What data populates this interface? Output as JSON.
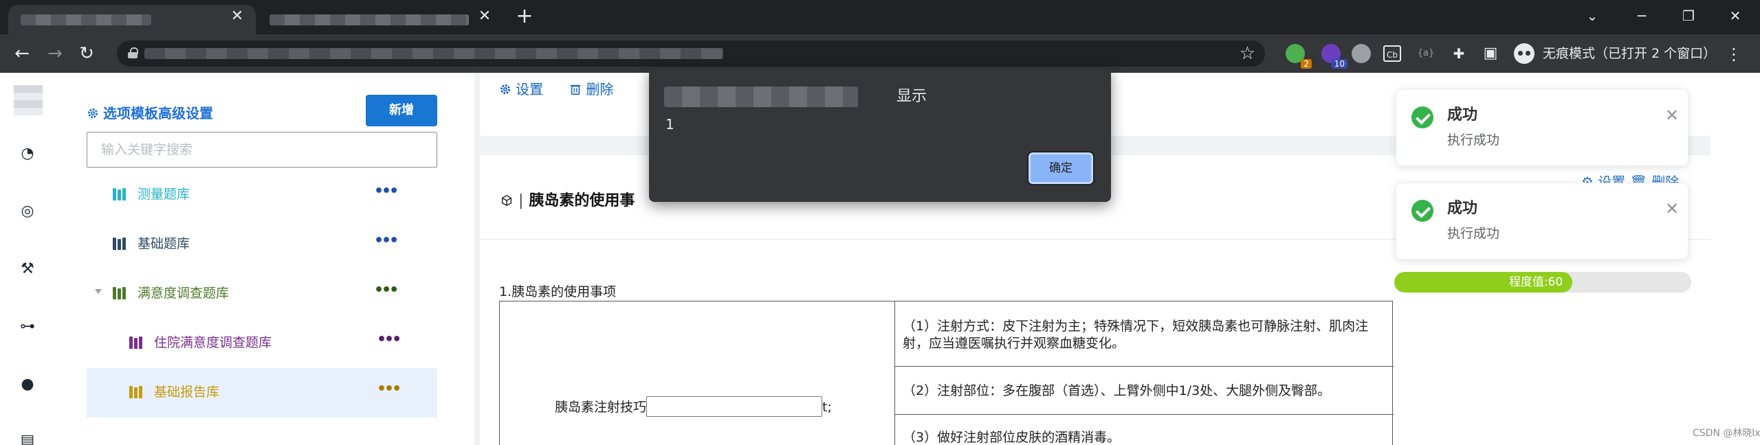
{
  "browser": {
    "tabs": [
      {
        "title": "",
        "active": true,
        "close_glyph": "✕"
      },
      {
        "title": "",
        "active": false,
        "close_glyph": "✕"
      }
    ],
    "new_tab_glyph": "+",
    "window_controls": {
      "menu": "⌄",
      "minimize": "─",
      "restore": "❐",
      "close": "✕"
    },
    "nav": {
      "back": "←",
      "forward": "→",
      "reload": "↻"
    },
    "url": "",
    "bookmark_glyph": "☆",
    "extensions": [
      {
        "icon": "green-circle-extension-icon",
        "badge": "2",
        "color": "#4caf50",
        "badge_color": "#c77800"
      },
      {
        "icon": "purple-extension-icon",
        "badge": "10",
        "color": "#6a3fbf",
        "badge_color": "#3949ab"
      },
      {
        "icon": "palette-icon",
        "badge": "",
        "color": "#9aa0a6",
        "badge_color": ""
      },
      {
        "icon": "cb-extension-icon",
        "badge": "",
        "label": "Cb",
        "color": "",
        "badge_color": ""
      },
      {
        "icon": "braces-extension-icon",
        "badge": "",
        "label": "{a}",
        "color": "",
        "badge_color": ""
      },
      {
        "icon": "puzzle-icon",
        "badge": "",
        "label": "✚",
        "color": "",
        "badge_color": ""
      },
      {
        "icon": "side-panel-icon",
        "badge": "",
        "label": "▣",
        "color": "",
        "badge_color": ""
      }
    ],
    "incognito_label": "无痕模式（已打开 2 个窗口）",
    "menu_glyph": "⋮"
  },
  "sidebar": {
    "icons": [
      "dashboard-icon",
      "target-icon",
      "tools-icon",
      "org-chart-icon",
      "user-icon",
      "document-icon"
    ],
    "glyphs": [
      "◔",
      "◎",
      "⚒",
      "⊶",
      "●",
      "▤"
    ]
  },
  "tree_panel": {
    "title": "选项模板高级设置",
    "add_button": "新增",
    "search_placeholder": "输入关键字搜索",
    "nodes": [
      {
        "label": "测量题库",
        "color": "#26b4c9",
        "indent": 0,
        "expandable": false,
        "selected": false
      },
      {
        "label": "基础题库",
        "color": "#2e4a62",
        "indent": 0,
        "expandable": false,
        "selected": false
      },
      {
        "label": "满意度调查题库",
        "color": "#4e7a2a",
        "indent": 0,
        "expandable": true,
        "selected": false
      },
      {
        "label": "住院满意度调查题库",
        "color": "#7b2e8e",
        "indent": 1,
        "expandable": false,
        "selected": false
      },
      {
        "label": "基础报告库",
        "color": "#c79a10",
        "indent": 1,
        "expandable": false,
        "selected": true
      }
    ],
    "more_glyph": "•••"
  },
  "main": {
    "card_actions": {
      "settings": "设置",
      "delete": "删除"
    },
    "ghost_actions": "⚙ 设置  🗑 删除",
    "section_title": "胰岛素的使用事",
    "question_title": "1.胰岛素的使用事项",
    "table": {
      "left_prefix": "胰岛素注射技巧",
      "left_suffix": "t;",
      "rows": [
        "（1）注射方式：皮下注射为主；特殊情况下，短效胰岛素也可静脉注射、肌肉注射，应当遵医嘱执行并观察血糖变化。",
        "（2）注射部位：多在腹部（首选）、上臂外侧中1/3处、大腿外侧及臀部。",
        "（3）做好注射部位皮肤的酒精消毒。"
      ]
    }
  },
  "notifications": [
    {
      "title": "成功",
      "message": "执行成功",
      "close_glyph": "✕"
    },
    {
      "title": "成功",
      "message": "执行成功",
      "close_glyph": "✕"
    }
  ],
  "progress": {
    "label": "程度值:60",
    "value": 60,
    "color": "#8fce1c"
  },
  "dialog": {
    "title": "显示",
    "message": "1",
    "ok_button": "确定"
  },
  "watermark": "CSDN @林晓lx"
}
